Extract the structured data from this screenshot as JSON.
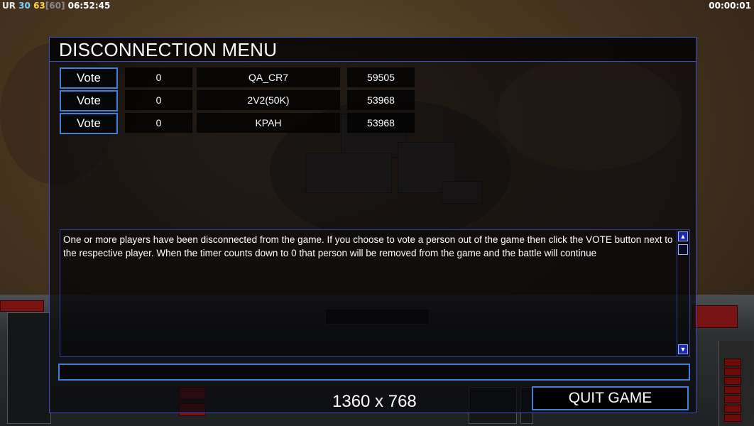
{
  "hud": {
    "top_left": {
      "label": "UR",
      "value_a": "30",
      "value_b": "63",
      "value_c": "[60]",
      "clock": "06:52:45"
    },
    "top_right_timer": "00:00:01"
  },
  "dialog": {
    "title": "DISCONNECTION MENU",
    "players": [
      {
        "vote_label": "Vote",
        "count": "0",
        "name": "QA_CR7",
        "id": "59505"
      },
      {
        "vote_label": "Vote",
        "count": "0",
        "name": "2V2(50K)",
        "id": "53968"
      },
      {
        "vote_label": "Vote",
        "count": "0",
        "name": "KPAH",
        "id": "53968"
      }
    ],
    "message": "One or more players have been disconnected from the game. If you choose to vote a person out of the game then click the VOTE button next to the respective player. When the timer counts down to 0 that person will be removed from the game and the battle will continue",
    "resolution": "1360 x 768",
    "quit_label": "QUIT GAME"
  },
  "icons": {
    "scroll_up": "scroll-up-arrow-icon",
    "scroll_down": "scroll-down-arrow-icon"
  },
  "colors": {
    "accent_border": "#3f7fd6",
    "panel_border": "#3b4dc6",
    "scroll_button": "#1c2aa8"
  }
}
